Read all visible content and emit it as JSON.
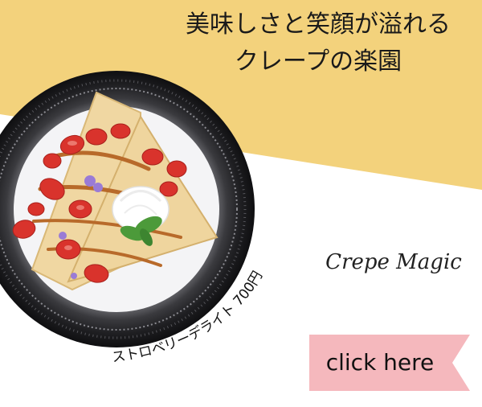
{
  "headline": {
    "line1": "美味しさと笑顔が溢れる",
    "line2": "クレープの楽園"
  },
  "product_caption": "ストロベリーデライト 700円",
  "brand_logo": "Crepe Magic",
  "cta_label": "click here",
  "colors": {
    "accent_yellow": "#f3d27c",
    "cta_pink": "#f5b8bd",
    "plate_rim": "#2b2b2e",
    "strawberry": "#d9332c",
    "crepe": "#f2d9a6",
    "caramel": "#b86a2a"
  }
}
